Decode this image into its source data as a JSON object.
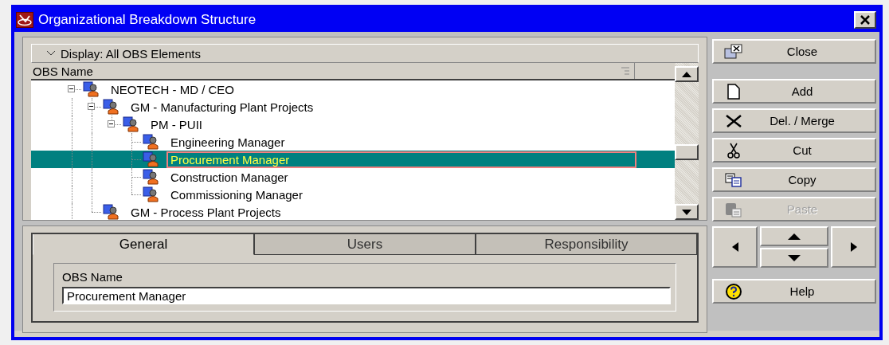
{
  "window": {
    "title": "Organizational Breakdown Structure"
  },
  "filter": {
    "label": "Display: All OBS Elements"
  },
  "tree": {
    "column": "OBS Name",
    "nodes": [
      {
        "label": "NEOTECH - MD / CEO",
        "expanded": true,
        "selected": false,
        "children": [
          {
            "label": "GM - Manufacturing Plant Projects",
            "expanded": true,
            "selected": false,
            "children": [
              {
                "label": "PM - PUII",
                "expanded": true,
                "selected": false,
                "children": [
                  {
                    "label": "Engineering Manager",
                    "selected": false
                  },
                  {
                    "label": "Procurement Manager",
                    "selected": true
                  },
                  {
                    "label": "Construction Manager",
                    "selected": false
                  },
                  {
                    "label": "Commissioning Manager",
                    "selected": false
                  }
                ]
              }
            ]
          },
          {
            "label": "GM - Process Plant Projects",
            "selected": false
          }
        ]
      }
    ]
  },
  "tabs": [
    {
      "label": "General",
      "selected": true
    },
    {
      "label": "Users",
      "selected": false
    },
    {
      "label": "Responsibility",
      "selected": false
    }
  ],
  "detail": {
    "label": "OBS Name",
    "value": "Procurement Manager"
  },
  "buttons": [
    {
      "label": "Close",
      "disabled": false
    },
    {
      "label": "Add",
      "disabled": false
    },
    {
      "label": "Del. / Merge",
      "disabled": false
    },
    {
      "label": "Cut",
      "disabled": false
    },
    {
      "label": "Copy",
      "disabled": false
    },
    {
      "label": "Paste",
      "disabled": true
    },
    {
      "label": "Help",
      "disabled": false
    }
  ]
}
